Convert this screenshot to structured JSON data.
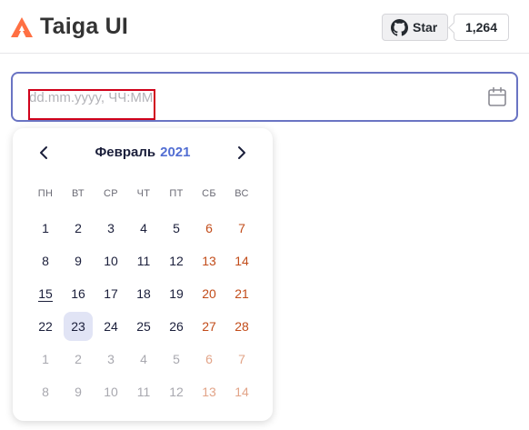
{
  "header": {
    "brand": "Taiga UI",
    "github_star_label": "Star",
    "github_star_count": "1,264",
    "logo_icon": "taiga-logo-icon",
    "logo_color": "#ff7043"
  },
  "input": {
    "placeholder": "dd.mm.yyyy, ЧЧ:ММ",
    "value": "",
    "icon": "calendar-icon",
    "border_color": "#6a74c3"
  },
  "calendar": {
    "month": "Февраль",
    "year": "2021",
    "prev_icon": "chevron-left-icon",
    "next_icon": "chevron-right-icon",
    "weekdays": [
      "ПН",
      "ВТ",
      "СР",
      "ЧТ",
      "ПТ",
      "СБ",
      "ВС"
    ],
    "weeks": [
      [
        {
          "d": "1",
          "state": "current"
        },
        {
          "d": "2",
          "state": "current"
        },
        {
          "d": "3",
          "state": "current"
        },
        {
          "d": "4",
          "state": "current"
        },
        {
          "d": "5",
          "state": "current"
        },
        {
          "d": "6",
          "state": "current-weekend"
        },
        {
          "d": "7",
          "state": "current-weekend"
        }
      ],
      [
        {
          "d": "8",
          "state": "current"
        },
        {
          "d": "9",
          "state": "current"
        },
        {
          "d": "10",
          "state": "current"
        },
        {
          "d": "11",
          "state": "current"
        },
        {
          "d": "12",
          "state": "current"
        },
        {
          "d": "13",
          "state": "current-weekend"
        },
        {
          "d": "14",
          "state": "current-weekend"
        }
      ],
      [
        {
          "d": "15",
          "state": "today"
        },
        {
          "d": "16",
          "state": "current"
        },
        {
          "d": "17",
          "state": "current"
        },
        {
          "d": "18",
          "state": "current"
        },
        {
          "d": "19",
          "state": "current"
        },
        {
          "d": "20",
          "state": "current-weekend"
        },
        {
          "d": "21",
          "state": "current-weekend"
        }
      ],
      [
        {
          "d": "22",
          "state": "current"
        },
        {
          "d": "23",
          "state": "selected"
        },
        {
          "d": "24",
          "state": "current"
        },
        {
          "d": "25",
          "state": "current"
        },
        {
          "d": "26",
          "state": "current"
        },
        {
          "d": "27",
          "state": "current-weekend"
        },
        {
          "d": "28",
          "state": "current-weekend"
        }
      ],
      [
        {
          "d": "1",
          "state": "other"
        },
        {
          "d": "2",
          "state": "other"
        },
        {
          "d": "3",
          "state": "other"
        },
        {
          "d": "4",
          "state": "other"
        },
        {
          "d": "5",
          "state": "other"
        },
        {
          "d": "6",
          "state": "other-weekend"
        },
        {
          "d": "7",
          "state": "other-weekend"
        }
      ],
      [
        {
          "d": "8",
          "state": "other"
        },
        {
          "d": "9",
          "state": "other"
        },
        {
          "d": "10",
          "state": "other"
        },
        {
          "d": "11",
          "state": "other"
        },
        {
          "d": "12",
          "state": "other"
        },
        {
          "d": "13",
          "state": "other-weekend"
        },
        {
          "d": "14",
          "state": "other-weekend"
        }
      ]
    ]
  }
}
